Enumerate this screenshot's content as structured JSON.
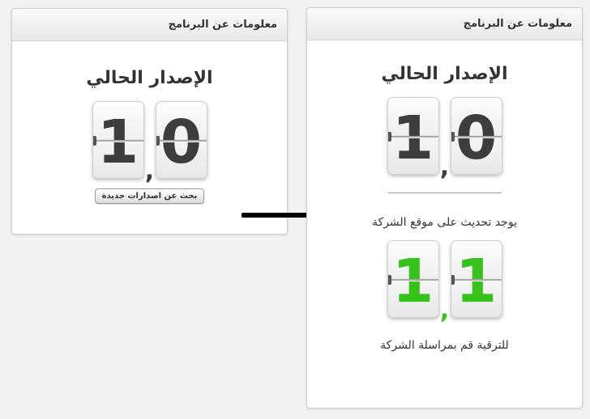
{
  "left_panel": {
    "header_title": "معلومات عن البرنامج",
    "version_title": "الإصدار الحالي",
    "current_version": {
      "major": "1",
      "minor": "0"
    },
    "check_button_label": "بحث عن اصدارات جديدة"
  },
  "right_panel": {
    "header_title": "معلومات عن البرنامج",
    "version_title": "الإصدار الحالي",
    "current_version": {
      "major": "1",
      "minor": "0"
    },
    "update_message": "يوجد تحديث على موقع الشركة",
    "new_version": {
      "major": "1",
      "minor": "1"
    },
    "upgrade_message": "للترقية قم بمراسلة الشركة"
  },
  "separator": ",",
  "colors": {
    "digit_default": "#3d3d3d",
    "digit_new": "#35c21a",
    "arrow": "#000000"
  },
  "icons": {
    "transition_arrow": "arrow-right-icon"
  }
}
